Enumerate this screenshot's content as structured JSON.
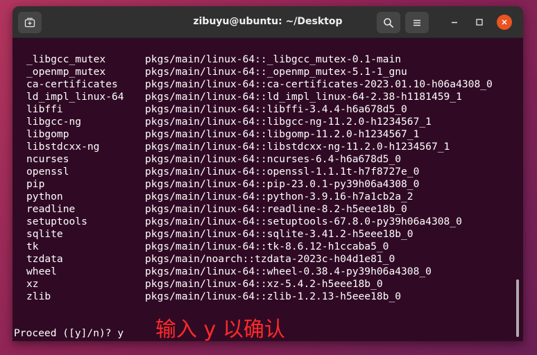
{
  "window": {
    "title": "zibuyu@ubuntu: ~/Desktop"
  },
  "titlebar_icons": {
    "new_tab": "new-tab-icon",
    "search": "search-icon",
    "menu": "hamburger-menu-icon",
    "minimize": "minimize-icon",
    "maximize": "maximize-icon",
    "close": "close-icon"
  },
  "colors": {
    "terminal_bg": "#300a24",
    "titlebar_bg": "#303030",
    "close_accent": "#e95420",
    "annotation": "#ff2a2a"
  },
  "packages": [
    {
      "name": "_libgcc_mutex",
      "source": "pkgs/main/linux-64::_libgcc_mutex-0.1-main"
    },
    {
      "name": "_openmp_mutex",
      "source": "pkgs/main/linux-64::_openmp_mutex-5.1-1_gnu"
    },
    {
      "name": "ca-certificates",
      "source": "pkgs/main/linux-64::ca-certificates-2023.01.10-h06a4308_0"
    },
    {
      "name": "ld_impl_linux-64",
      "source": "pkgs/main/linux-64::ld_impl_linux-64-2.38-h1181459_1"
    },
    {
      "name": "libffi",
      "source": "pkgs/main/linux-64::libffi-3.4.4-h6a678d5_0"
    },
    {
      "name": "libgcc-ng",
      "source": "pkgs/main/linux-64::libgcc-ng-11.2.0-h1234567_1"
    },
    {
      "name": "libgomp",
      "source": "pkgs/main/linux-64::libgomp-11.2.0-h1234567_1"
    },
    {
      "name": "libstdcxx-ng",
      "source": "pkgs/main/linux-64::libstdcxx-ng-11.2.0-h1234567_1"
    },
    {
      "name": "ncurses",
      "source": "pkgs/main/linux-64::ncurses-6.4-h6a678d5_0"
    },
    {
      "name": "openssl",
      "source": "pkgs/main/linux-64::openssl-1.1.1t-h7f8727e_0"
    },
    {
      "name": "pip",
      "source": "pkgs/main/linux-64::pip-23.0.1-py39h06a4308_0"
    },
    {
      "name": "python",
      "source": "pkgs/main/linux-64::python-3.9.16-h7a1cb2a_2"
    },
    {
      "name": "readline",
      "source": "pkgs/main/linux-64::readline-8.2-h5eee18b_0"
    },
    {
      "name": "setuptools",
      "source": "pkgs/main/linux-64::setuptools-67.8.0-py39h06a4308_0"
    },
    {
      "name": "sqlite",
      "source": "pkgs/main/linux-64::sqlite-3.41.2-h5eee18b_0"
    },
    {
      "name": "tk",
      "source": "pkgs/main/linux-64::tk-8.6.12-h1ccaba5_0"
    },
    {
      "name": "tzdata",
      "source": "pkgs/main/noarch::tzdata-2023c-h04d1e81_0"
    },
    {
      "name": "wheel",
      "source": "pkgs/main/linux-64::wheel-0.38.4-py39h06a4308_0"
    },
    {
      "name": "xz",
      "source": "pkgs/main/linux-64::xz-5.4.2-h5eee18b_0"
    },
    {
      "name": "zlib",
      "source": "pkgs/main/linux-64::zlib-1.2.13-h5eee18b_0"
    }
  ],
  "prompt": {
    "text": "Proceed ([y]/n)? y"
  },
  "annotation": {
    "text": "输入 y 以确认"
  }
}
